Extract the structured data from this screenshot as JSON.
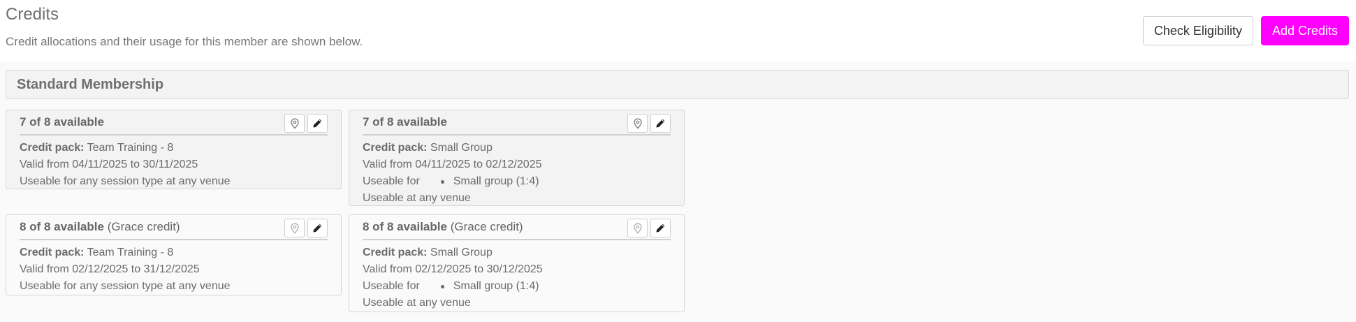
{
  "header": {
    "title": "Credits",
    "subtitle": "Credit allocations and their usage for this member are shown below."
  },
  "actions": {
    "check_eligibility": "Check Eligibility",
    "add_credits": "Add Credits"
  },
  "section": {
    "title": "Standard Membership"
  },
  "labels": {
    "credit_pack": "Credit pack:",
    "useable_for": "Useable for",
    "useable_at_any_venue": "Useable at any venue",
    "useable_any": "Useable for any session type at any venue"
  },
  "cards": [
    {
      "availability": "7 of 8 available",
      "note": "",
      "pack": "Team Training - 8",
      "valid": "Valid from 04/11/2025 to 30/11/2025",
      "session": ""
    },
    {
      "availability": "7 of 8 available",
      "note": "",
      "pack": "Small Group",
      "valid": "Valid from 04/11/2025 to 02/12/2025",
      "session": "Small group (1:4)"
    },
    {
      "availability": "8 of 8 available",
      "note": "(Grace credit)",
      "pack": "Team Training - 8",
      "valid": "Valid from 02/12/2025 to 31/12/2025",
      "session": ""
    },
    {
      "availability": "8 of 8 available",
      "note": "(Grace credit)",
      "pack": "Small Group",
      "valid": "Valid from 02/12/2025 to 30/12/2025",
      "session": "Small group (1:4)"
    }
  ],
  "icons": {
    "venue": "map-pin-icon",
    "edit": "pencil-icon"
  }
}
